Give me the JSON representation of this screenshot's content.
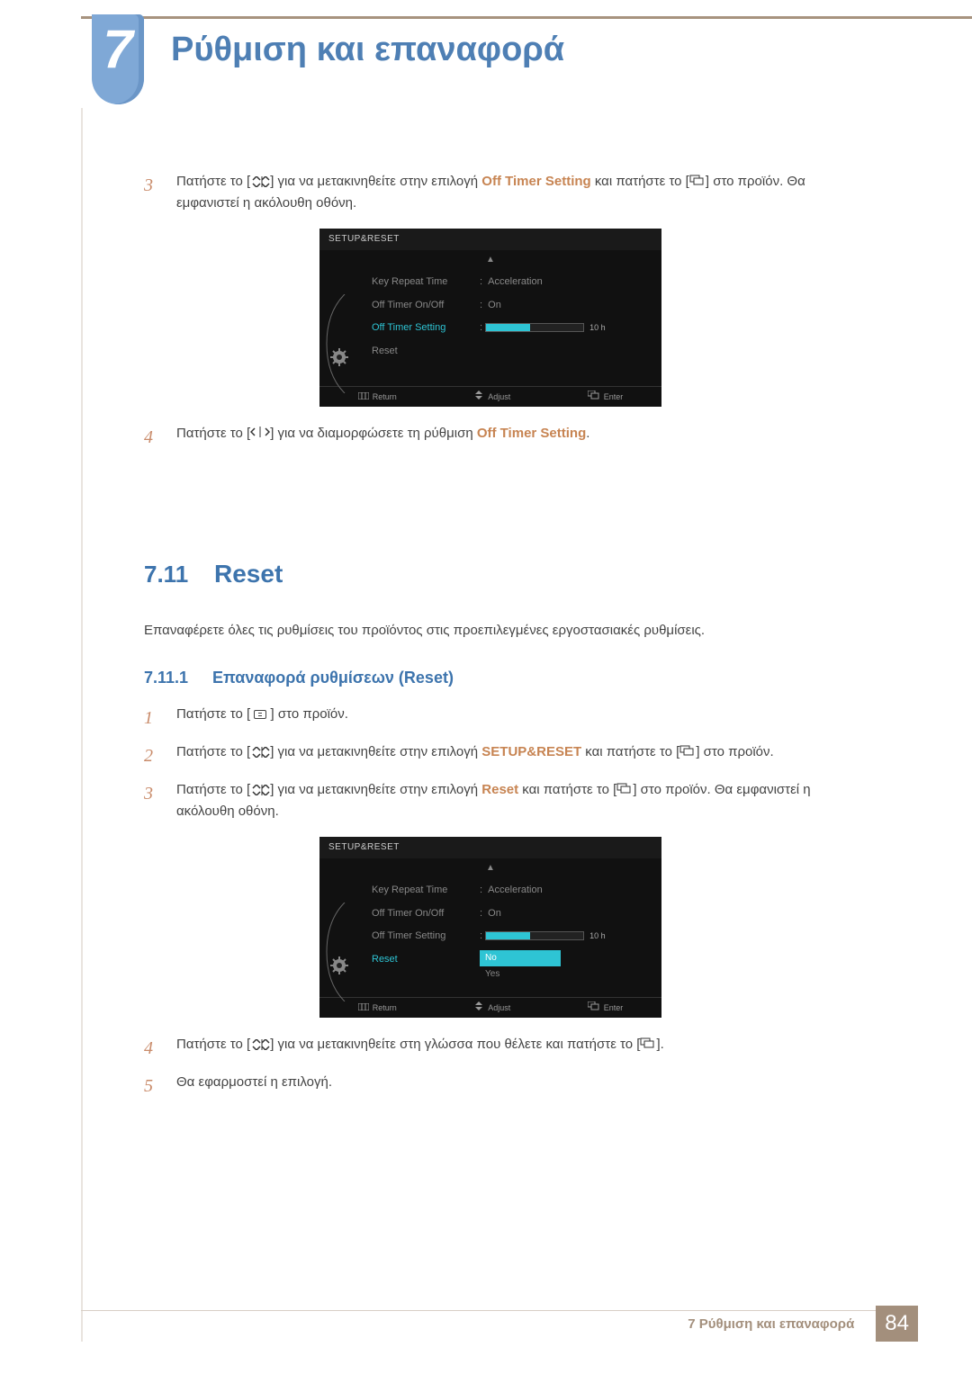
{
  "chapter": {
    "number": "7",
    "title": "Ρύθμιση και επαναφορά"
  },
  "topSteps": {
    "s3": {
      "num": "3",
      "pre": "Πατήστε το [",
      "mid1": "] για να μετακινηθείτε στην επιλογή ",
      "highlight": "Off Timer Setting",
      "mid2": " και πατήστε το [",
      "post": "] στο προϊόν. Θα εμφανιστεί η ακόλουθη οθόνη."
    },
    "s4": {
      "num": "4",
      "pre": "Πατήστε το [",
      "mid": "] για να διαμορφώσετε τη ρύθμιση ",
      "highlight": "Off Timer Setting",
      "post": "."
    }
  },
  "osd": {
    "title": "SETUP&RESET",
    "items": {
      "keyRepeat": "Key Repeat Time",
      "offTimerOnOff": "Off Timer On/Off",
      "offTimerSetting": "Off Timer Setting",
      "reset": "Reset"
    },
    "vals": {
      "acceleration": "Acceleration",
      "on": "On",
      "sliderLabel": "10 h",
      "no": "No",
      "yes": "Yes"
    },
    "footer": {
      "return": "Return",
      "adjust": "Adjust",
      "enter": "Enter"
    }
  },
  "section": {
    "num": "7.11",
    "title": "Reset",
    "desc": "Επαναφέρετε όλες τις ρυθμίσεις του προϊόντος στις προεπιλεγμένες εργοστασιακές ρυθμίσεις."
  },
  "subsection": {
    "num": "7.11.1",
    "title": "Επαναφορά ρυθμίσεων (Reset)",
    "s1": {
      "num": "1",
      "pre": "Πατήστε το [ ",
      "post": " ] στο προϊόν."
    },
    "s2": {
      "num": "2",
      "pre": "Πατήστε το [",
      "mid1": "] για να μετακινηθείτε στην επιλογή ",
      "highlight": "SETUP&RESET",
      "mid2": " και πατήστε το [",
      "post": "] στο προϊόν."
    },
    "s3": {
      "num": "3",
      "pre": "Πατήστε το [",
      "mid1": "] για να μετακινηθείτε στην επιλογή ",
      "highlight": "Reset",
      "mid2": " και πατήστε το [",
      "post": "] στο προϊόν. Θα εμφανιστεί η ακόλουθη οθόνη."
    },
    "s4": {
      "num": "4",
      "pre": "Πατήστε το [",
      "mid": "] για να μετακινηθείτε στη γλώσσα που θέλετε και πατήστε το [",
      "post": "]."
    },
    "s5": {
      "num": "5",
      "text": "Θα εφαρμοστεί η επιλογή."
    }
  },
  "pageFooter": {
    "label": "7 Ρύθμιση και επαναφορά",
    "page": "84"
  }
}
